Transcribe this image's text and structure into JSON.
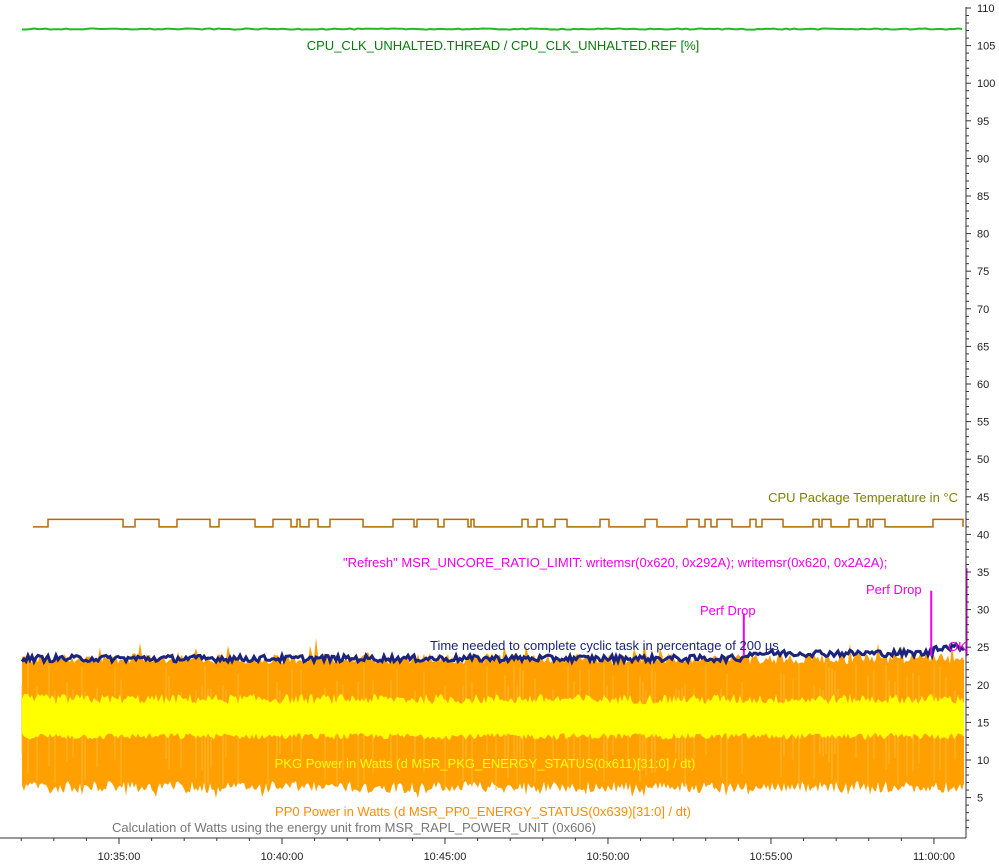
{
  "chart_data": {
    "type": "line",
    "y_range": [
      0,
      110
    ],
    "y_ticks": [
      "5",
      "10",
      "15",
      "20",
      "25",
      "30",
      "35",
      "40",
      "45",
      "50",
      "55",
      "60",
      "65",
      "70",
      "75",
      "80",
      "85",
      "90",
      "95",
      "100",
      "105",
      "110"
    ],
    "x_range": [
      "10:31:45",
      "11:03:00"
    ],
    "x_ticks": [
      "10:35:00",
      "10:40:00",
      "10:45:00",
      "10:50:00",
      "10:55:00",
      "11:00:00"
    ],
    "grid": false,
    "series": [
      {
        "name": "CPU_CLK_UNHALTED.THREAD / CPU_CLK_UNHALTED.REF [%]",
        "color": "#22bb22",
        "level": 107.2
      },
      {
        "name": "CPU Package Temperature in °C",
        "color": "#b36b00",
        "levels": [
          41,
          42
        ]
      },
      {
        "name": "Time needed to complete cyclic task in percentage of 200 µs",
        "color": "#1a237e",
        "points": [
          [
            "10:31:45",
            23.5
          ],
          [
            "10:54:10",
            23.5
          ],
          [
            "10:54:12",
            24.2
          ],
          [
            "10:59:55",
            24.2
          ],
          [
            "10:59:57",
            25.0
          ],
          [
            "11:01:00",
            25.0
          ],
          [
            "11:01:02",
            23.5
          ],
          [
            "11:03:00",
            23.5
          ]
        ]
      },
      {
        "name": "PKG Power in Watts (d MSR_PKG_ENERGY_STATUS(0x611)[31:0] / dt)",
        "color": "#ffa000",
        "band": [
          5,
          24
        ]
      },
      {
        "name": "PP0 Power in Watts (d MSR_PP0_ENERGY_STATUS(0x639)[31:0] / dt)",
        "color": "#ffff00",
        "band": [
          13,
          18
        ]
      }
    ],
    "annotations": [
      {
        "text": "\"Refresh\" MSR_UNCORE_RATIO_LIMIT: writemsr(0x620, 0x292A); writemsr(0x620, 0x2A2A);",
        "color": "#ee00ee"
      },
      {
        "text": "Perf Drop",
        "color": "#ee00ee",
        "x": "10:54:10",
        "spike": 29.5
      },
      {
        "text": "Perf Drop",
        "color": "#ee00ee",
        "x": "10:59:55",
        "spike": 32.5
      },
      {
        "text": "OK",
        "color": "#ee00ee",
        "x": "11:01:00",
        "spike": 35.5
      },
      {
        "text": "Calculation of Watts using the energy unit from MSR_RAPL_POWER_UNIT (0x606)",
        "color": "#777777"
      }
    ]
  }
}
